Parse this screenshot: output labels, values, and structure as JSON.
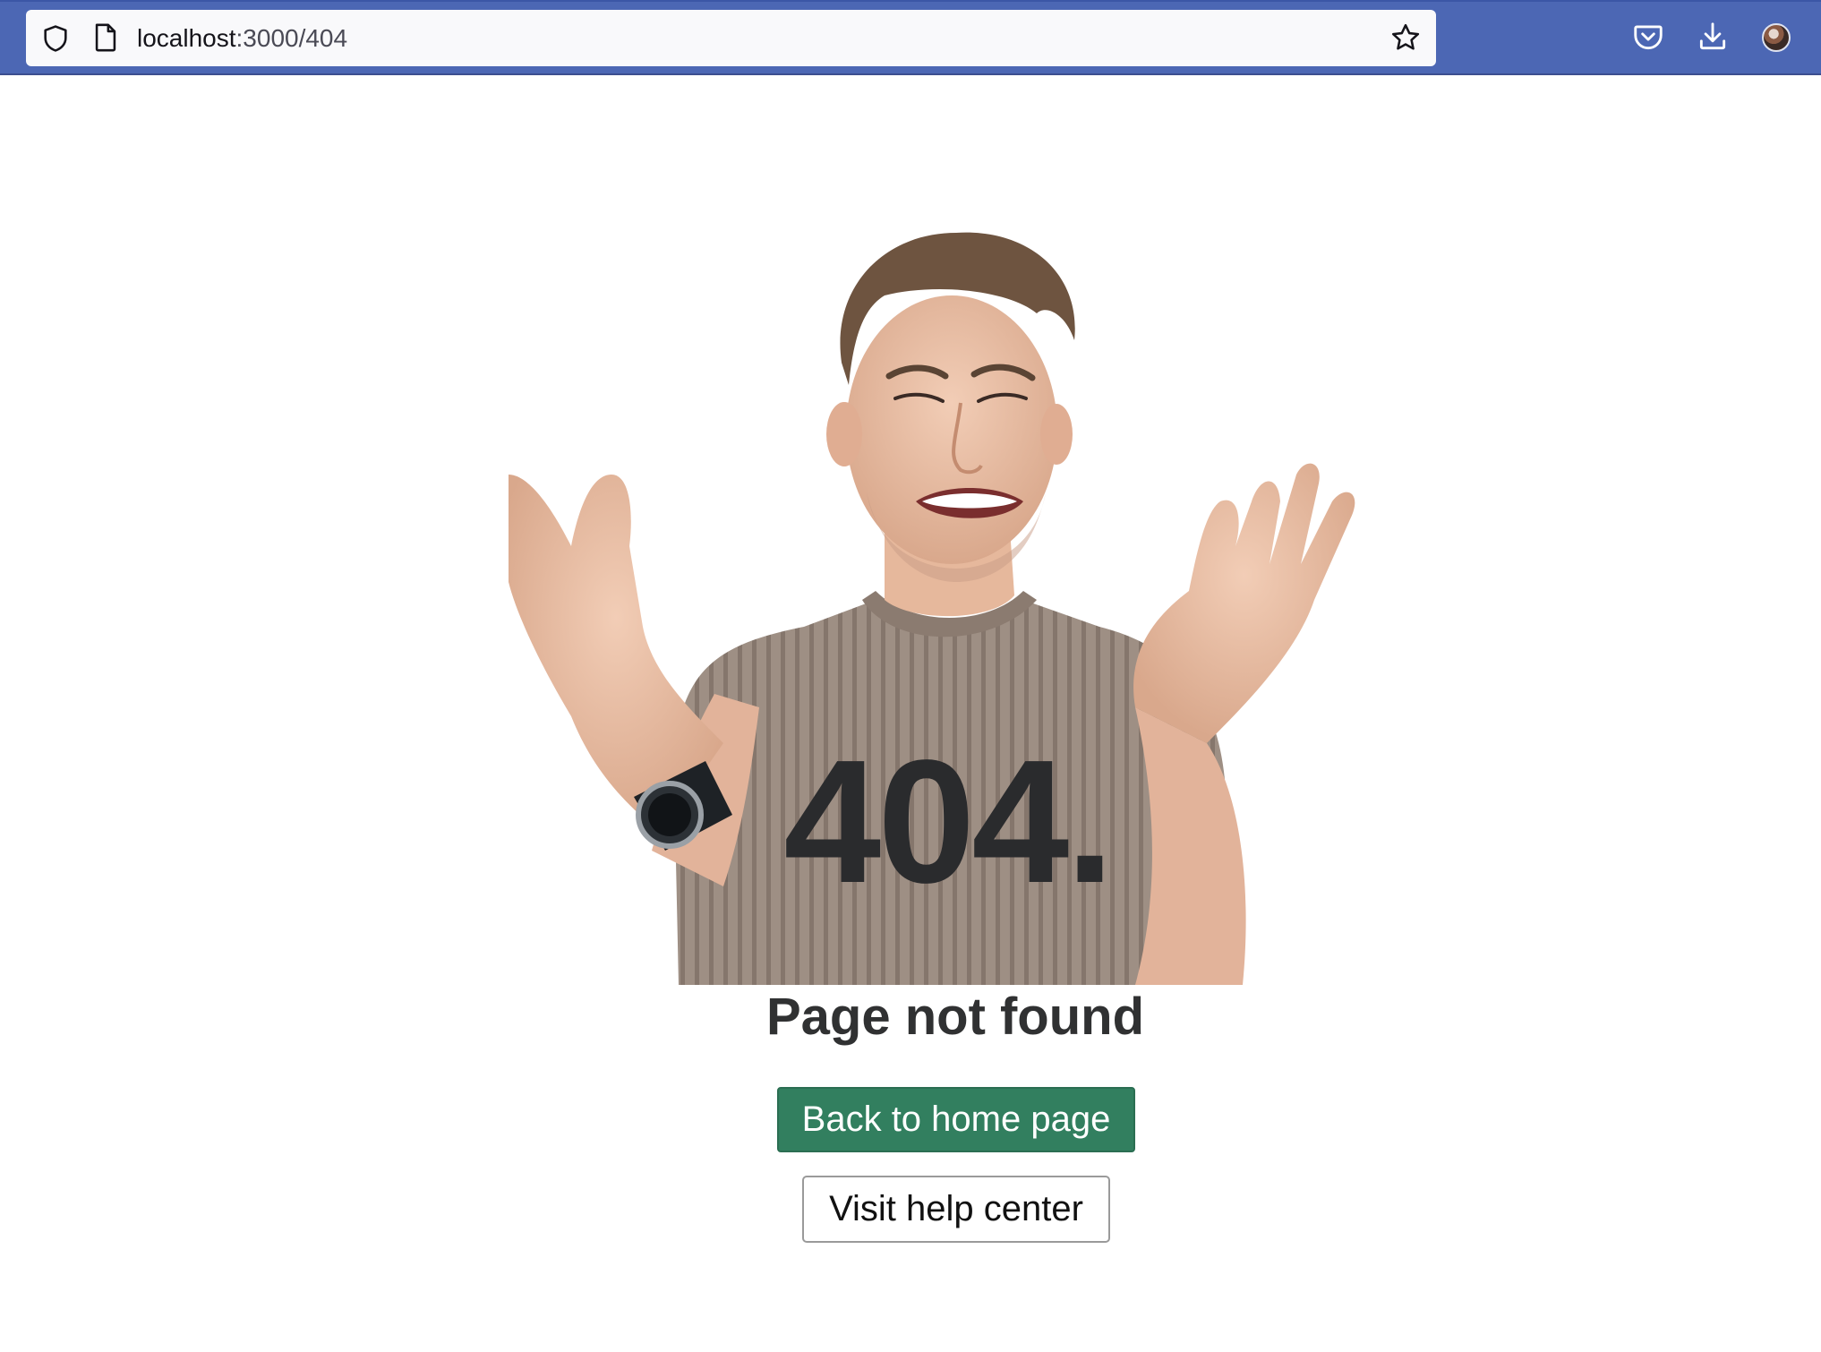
{
  "browser": {
    "url_host": "localhost",
    "url_path": ":3000/404",
    "icons": {
      "site_info": "shield-icon",
      "page": "page-icon",
      "bookmark": "star-icon",
      "pocket": "pocket-icon",
      "downloads": "download-icon",
      "account": "avatar"
    },
    "colors": {
      "toolbar": "#4c67b4",
      "urlbar": "#f9f9fb"
    }
  },
  "page": {
    "error_code": "404.",
    "title": "Page not found",
    "primary_button": "Back to home page",
    "secondary_button": "Visit help center",
    "colors": {
      "primary": "#327f5f",
      "text": "#303132"
    }
  }
}
